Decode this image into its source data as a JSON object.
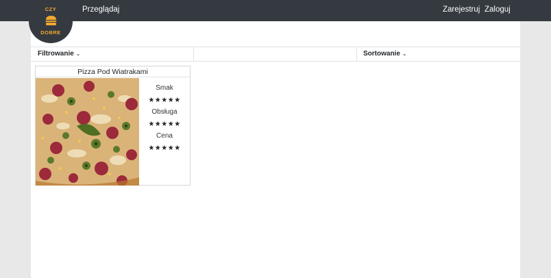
{
  "navbar": {
    "browse_label": "Przeglądaj",
    "register_label": "Zarejestruj",
    "login_label": "Zaloguj"
  },
  "logo": {
    "top_text": "CZY",
    "bottom_text": "DOBRE",
    "icon": "burger-icon"
  },
  "toolbar": {
    "filter_label": "Filtrowanie",
    "sort_label": "Sortowanie",
    "caret_icon": "chevron-down-icon"
  },
  "restaurants": [
    {
      "name": "Pizza Pod Wiatrakami",
      "image": "pizza-photo",
      "ratings": [
        {
          "label": "Smak",
          "stars": "★★★★★",
          "value": 5
        },
        {
          "label": "Obsługa",
          "stars": "★★★★★",
          "value": 5
        },
        {
          "label": "Cena",
          "stars": "★★★★★",
          "value": 5
        }
      ]
    }
  ],
  "colors": {
    "navbar": "#343a40",
    "page_background": "#e8e8e8",
    "content_background": "#ffffff",
    "logo_text": "#f0a830"
  }
}
